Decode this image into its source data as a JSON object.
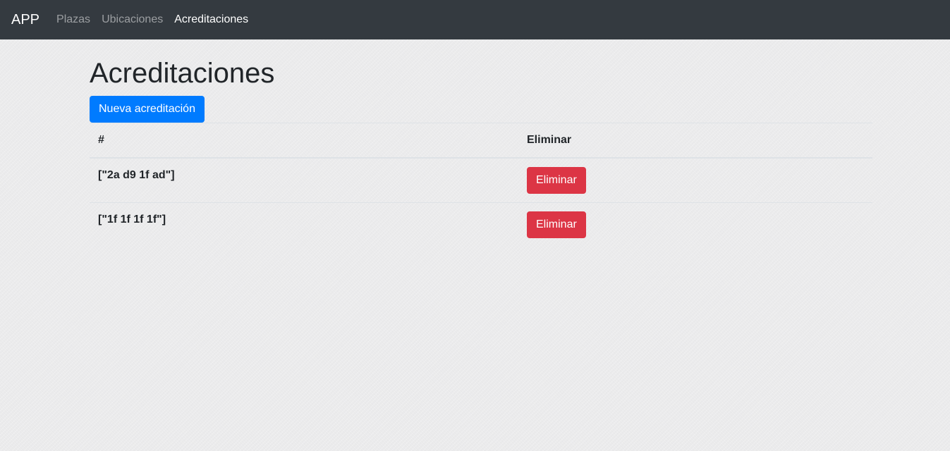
{
  "navbar": {
    "brand": "APP",
    "links": [
      {
        "label": "Plazas",
        "active": false
      },
      {
        "label": "Ubicaciones",
        "active": false
      },
      {
        "label": "Acreditaciones",
        "active": true
      }
    ]
  },
  "main": {
    "title": "Acreditaciones",
    "new_button_label": "Nueva acreditación",
    "table": {
      "headers": [
        "#",
        "Eliminar"
      ],
      "rows": [
        {
          "id": "[\"2a d9 1f ad\"]",
          "action_label": "Eliminar"
        },
        {
          "id": "[\"1f 1f 1f 1f\"]",
          "action_label": "Eliminar"
        }
      ]
    }
  },
  "colors": {
    "navbar_bg": "#343a40",
    "primary": "#007bff",
    "danger": "#dc3545",
    "page_bg": "#ebebec"
  }
}
